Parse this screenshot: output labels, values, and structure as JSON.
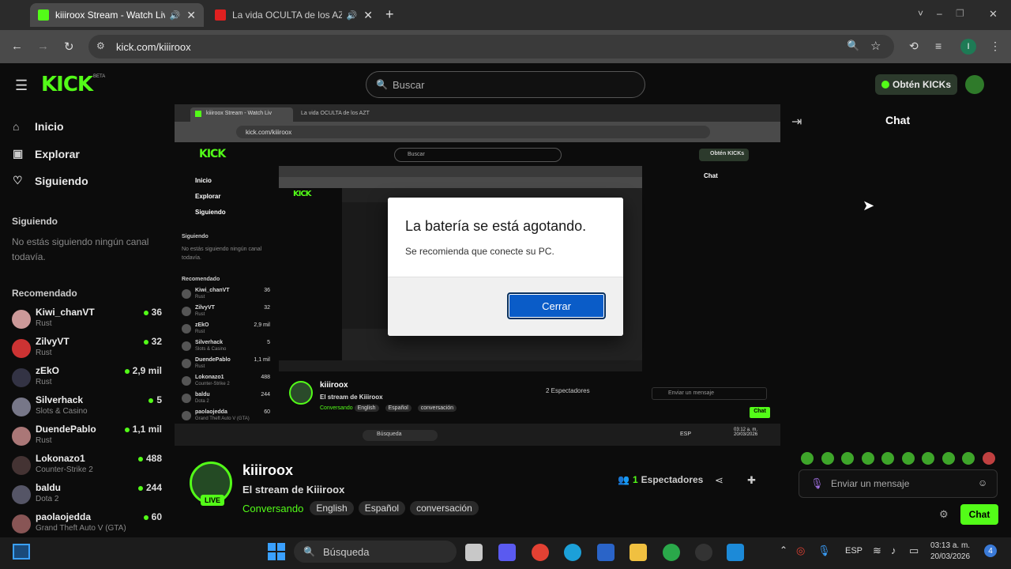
{
  "browser": {
    "tabs": [
      {
        "title": "kiiiroox Stream - Watch Live",
        "active": true
      },
      {
        "title": "La vida OCULTA de los AZT",
        "active": false
      }
    ],
    "new_tab": "+",
    "url": "kick.com/kiiiroox",
    "profile_initial": "I",
    "window_controls": [
      "˅",
      "–",
      "❐",
      "✕"
    ]
  },
  "header": {
    "logo": "KICK",
    "beta": "BETA",
    "search_placeholder": "Buscar",
    "kicks_button": "Obtén KICKs"
  },
  "sidebar": {
    "nav": [
      {
        "label": "Inicio",
        "icon": "home-icon"
      },
      {
        "label": "Explorar",
        "icon": "compass-icon"
      },
      {
        "label": "Siguiendo",
        "icon": "heart-icon"
      }
    ],
    "following_title": "Siguiendo",
    "following_empty": "No estás siguiendo ningún canal todavía.",
    "recommended_title": "Recomendado",
    "recommended": [
      {
        "name": "Kiwi_chanVT",
        "category": "Rust",
        "viewers": "36",
        "color": "#c99"
      },
      {
        "name": "ZilvyVT",
        "category": "Rust",
        "viewers": "32",
        "color": "#c33"
      },
      {
        "name": "zEkO",
        "category": "Rust",
        "viewers": "2,9 mil",
        "color": "#334"
      },
      {
        "name": "Silverhack",
        "category": "Slots & Casino",
        "viewers": "5",
        "color": "#778"
      },
      {
        "name": "DuendePablo",
        "category": "Rust",
        "viewers": "1,1 mil",
        "color": "#a77"
      },
      {
        "name": "Lokonazo1",
        "category": "Counter-Strike 2",
        "viewers": "488",
        "color": "#433"
      },
      {
        "name": "baldu",
        "category": "Dota 2",
        "viewers": "244",
        "color": "#556"
      },
      {
        "name": "paolaojedda",
        "category": "Grand Theft Auto V (GTA)",
        "viewers": "60",
        "color": "#855"
      }
    ]
  },
  "stream": {
    "channel": "kiiiroox",
    "title": "El stream de Kiiiroox",
    "live_badge": "LIVE",
    "viewers_count": "1",
    "viewers_label": "Espectadores",
    "tags": [
      "Conversando",
      "English",
      "Español",
      "conversación"
    ]
  },
  "chat": {
    "title": "Chat",
    "input_placeholder": "Enviar un mensaje",
    "send_button": "Chat"
  },
  "dialog": {
    "title": "La batería se está agotando.",
    "message": "Se recomienda que conecte su PC.",
    "button": "Cerrar"
  },
  "nested": {
    "tab1": "kiiiroox Stream - Watch Liv",
    "tab2": "La vida OCULTA de los AZT",
    "url": "kick.com/kiiiroox",
    "search": "Buscar",
    "kicks": "Obtén KICKs",
    "chat": "Chat",
    "nav": [
      "Inicio",
      "Explorar",
      "Siguiendo"
    ],
    "following_title": "Siguiendo",
    "following_empty": "No estás siguiendo ningún canal todavía.",
    "recommended_title": "Recomendado",
    "recommended": [
      {
        "name": "Kiwi_chanVT",
        "category": "Rust",
        "viewers": "36"
      },
      {
        "name": "ZilvyVT",
        "category": "Rust",
        "viewers": "32"
      },
      {
        "name": "zEkO",
        "category": "Rust",
        "viewers": "2,9 mil"
      },
      {
        "name": "Silverhack",
        "category": "Slots & Casino",
        "viewers": "5"
      },
      {
        "name": "DuendePablo",
        "category": "Rust",
        "viewers": "1,1 mil"
      },
      {
        "name": "Lokonazo1",
        "category": "Counter-Strike 2",
        "viewers": "488"
      },
      {
        "name": "baldu",
        "category": "Dota 2",
        "viewers": "244"
      },
      {
        "name": "paolaojedda",
        "category": "Grand Theft Auto V (GTA)",
        "viewers": "60"
      }
    ],
    "channel": "kiiiroox",
    "stream_title": "El stream de Kiiiroox",
    "viewers": "2 Espectadores",
    "tags": [
      "Conversando",
      "English",
      "Español",
      "conversación"
    ],
    "chat_input": "Enviar un mensaje",
    "chat_btn": "Chat",
    "taskbar_search": "Búsqueda",
    "lang": "ESP",
    "time": "03:12 a. m.",
    "date": "20/03/2026"
  },
  "taskbar": {
    "search": "Búsqueda",
    "lang": "ESP",
    "time": "03:13 a. m.",
    "date": "20/03/2026",
    "notifications": "4"
  },
  "colors": {
    "brand": "#53fc18",
    "dialog_button": "#0a5cc8"
  }
}
